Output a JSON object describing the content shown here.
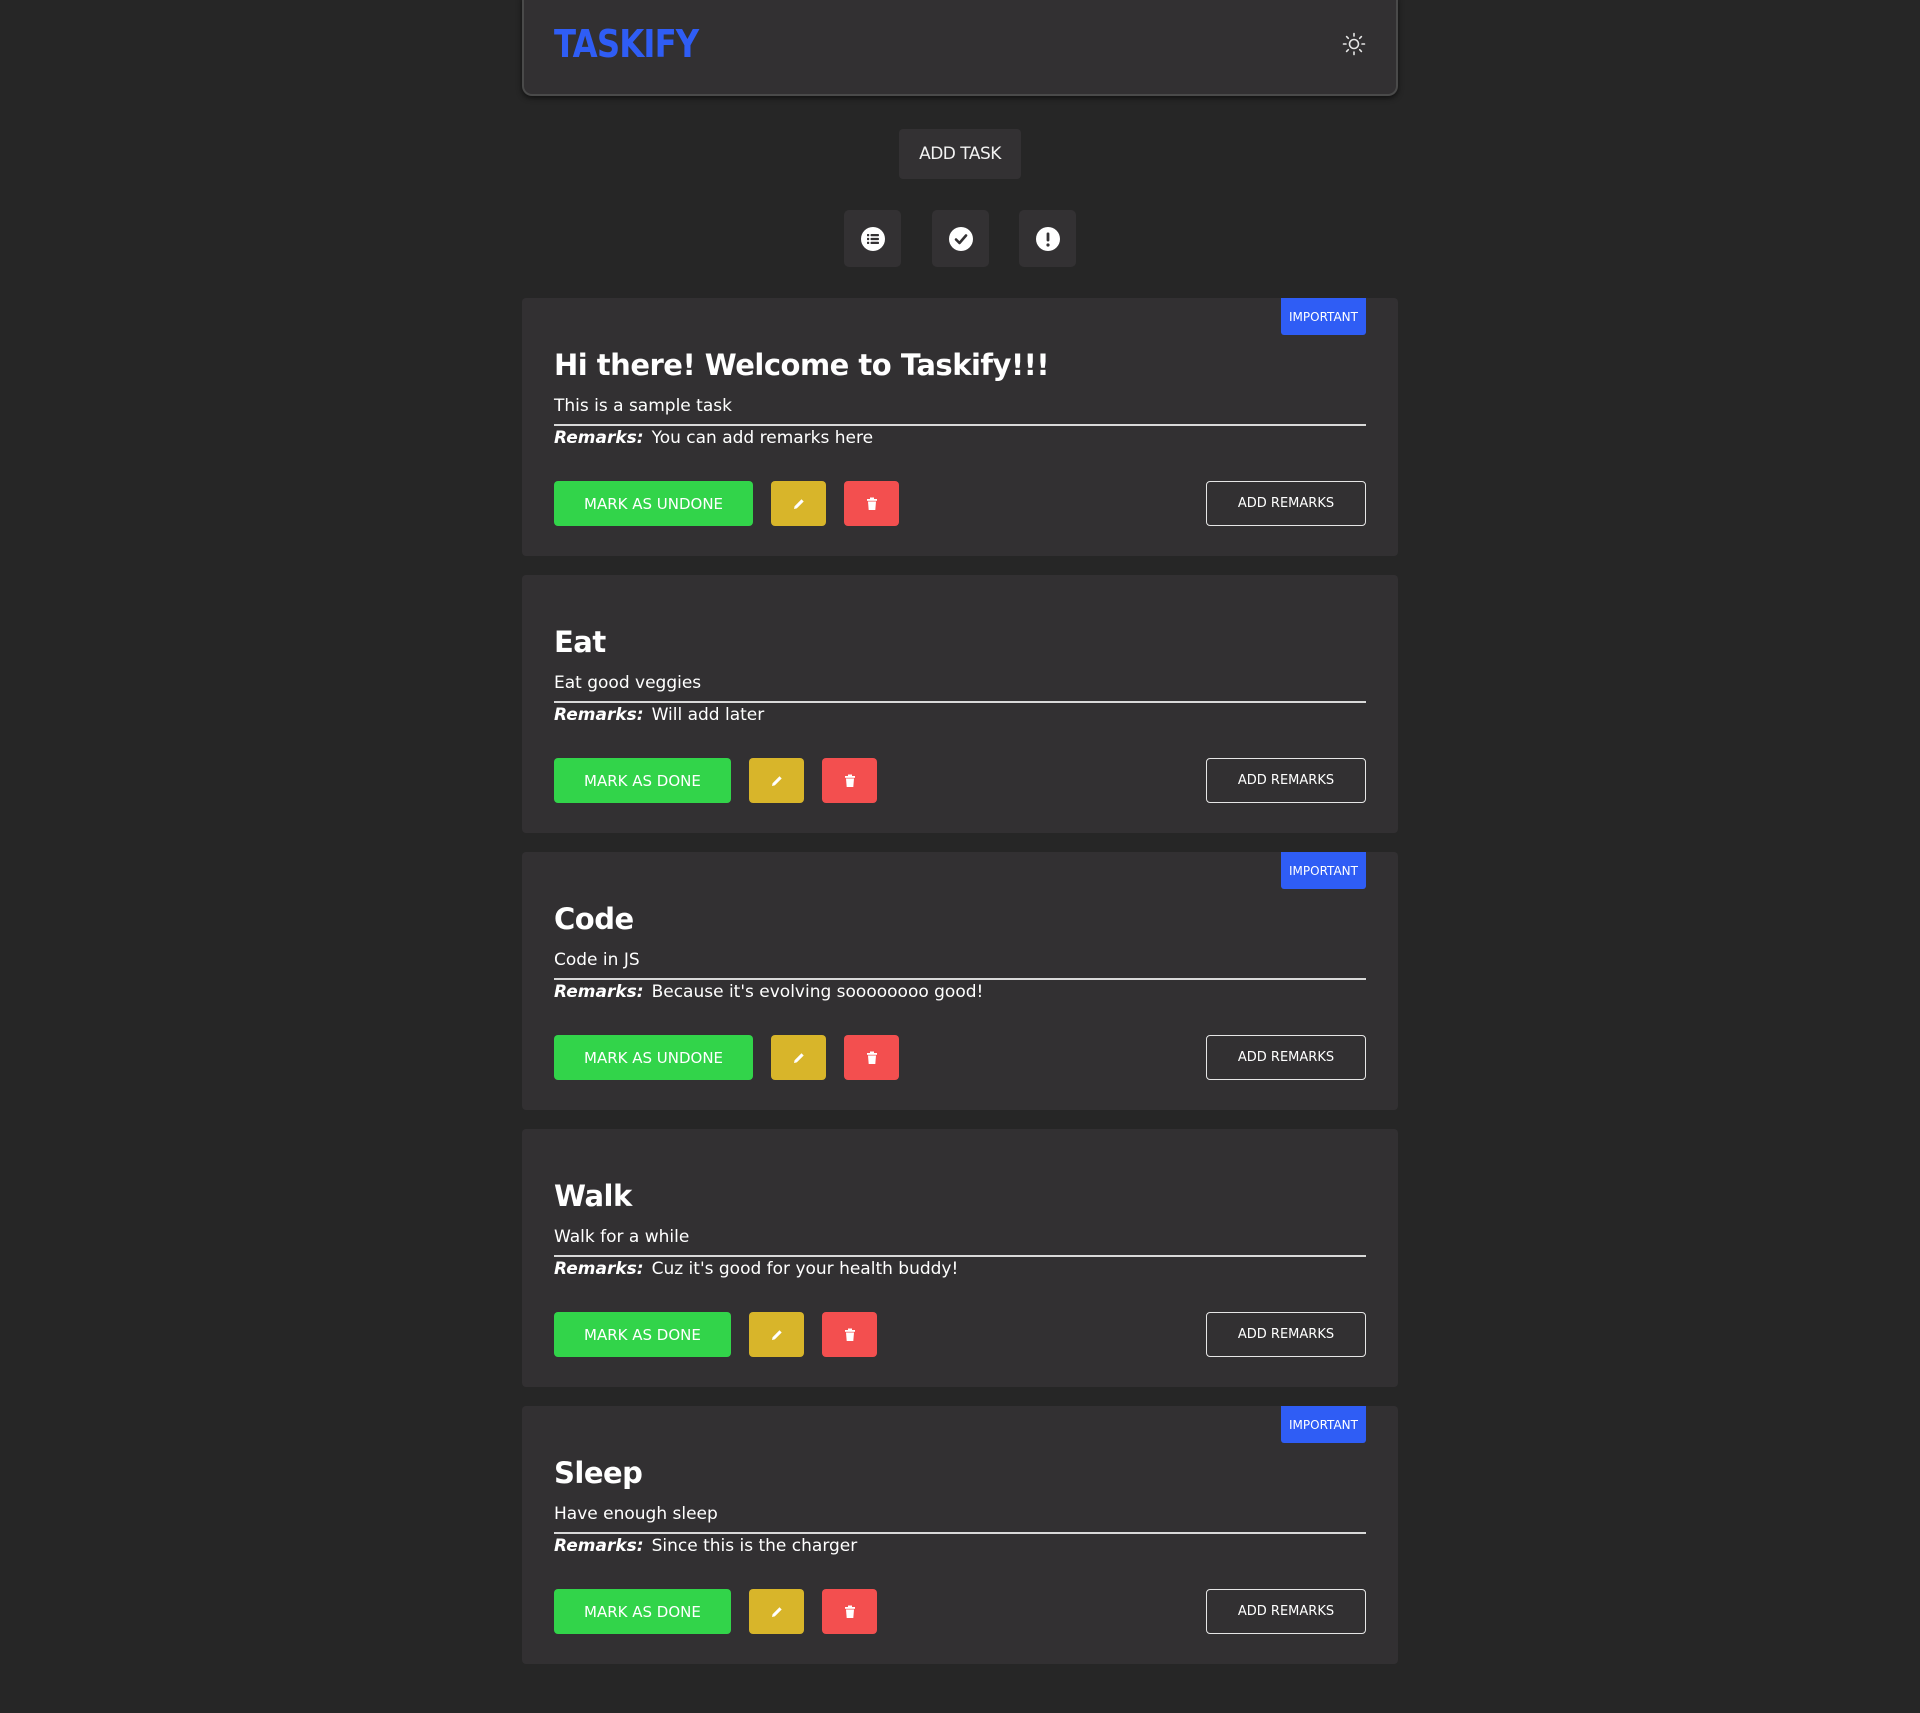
{
  "app": {
    "brand": "TASKIFY",
    "add_task_label": "ADD TASK",
    "theme_icon": "sun-icon",
    "filters": [
      {
        "name": "all-tasks",
        "icon": "list-icon"
      },
      {
        "name": "completed-tasks",
        "icon": "check-circle-icon"
      },
      {
        "name": "important-tasks",
        "icon": "exclamation-circle-icon"
      }
    ]
  },
  "labels": {
    "remarks": "Remarks:",
    "add_remarks": "ADD REMARKS",
    "important": "IMPORTANT"
  },
  "colors": {
    "background": "#262626",
    "card": "#323032",
    "brand": "#2f5df5",
    "done_button": "#32d44a",
    "edit_button": "#d8b52a",
    "delete_button": "#f34f4f",
    "important_badge": "#2f5df5"
  },
  "tasks": [
    {
      "title": "Hi there! Welcome to Taskify!!!",
      "description": "This is a sample task",
      "remarks": "You can add remarks here",
      "important": true,
      "status_button": "MARK AS UNDONE"
    },
    {
      "title": "Eat",
      "description": "Eat good veggies",
      "remarks": "Will add later",
      "important": false,
      "status_button": "MARK AS DONE"
    },
    {
      "title": "Code",
      "description": "Code in JS",
      "remarks": "Because it's evolving soooooooo good!",
      "important": true,
      "status_button": "MARK AS UNDONE"
    },
    {
      "title": "Walk",
      "description": "Walk for a while",
      "remarks": "Cuz it's good for your health buddy!",
      "important": false,
      "status_button": "MARK AS DONE"
    },
    {
      "title": "Sleep",
      "description": "Have enough sleep",
      "remarks": "Since this is the charger",
      "important": true,
      "status_button": "MARK AS DONE"
    }
  ]
}
